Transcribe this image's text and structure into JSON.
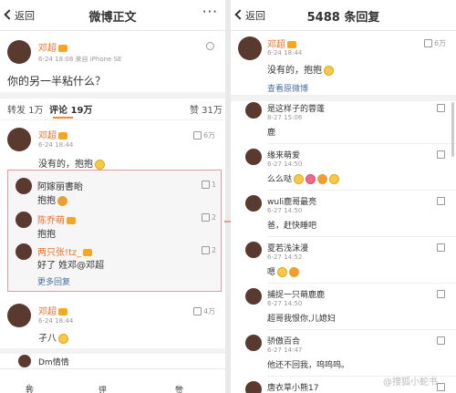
{
  "left": {
    "back_label": "返回",
    "title": "微博正文",
    "more": "···",
    "post": {
      "author": "邓超",
      "meta": "6-24 18:08  来自 iPhone SE",
      "text": "你的另一半粘什么？"
    },
    "tabs": {
      "repost": "转发 1万",
      "comment": "评论 19万",
      "like": "赞 31万"
    },
    "comment1": {
      "author": "邓超",
      "meta": "6-24 18:44",
      "likes": "6万",
      "text": "没有的，抱抱",
      "replies": [
        {
          "author": "阿嫁丽書眙",
          "text": "抱抱",
          "likes": "1"
        },
        {
          "author": "陈乔萌",
          "text": "抱抱",
          "likes": "2"
        },
        {
          "author": "两只张!tz_",
          "text": "好了  姓邓@邓超",
          "likes": "2"
        }
      ],
      "more_replies": "更多回复"
    },
    "comment2": {
      "author": "邓超",
      "meta": "6-24 18:44",
      "likes": "4万",
      "text": "孑八"
    },
    "comment3": {
      "author": "Dm情情"
    },
    "bottom": {
      "repost": "转发",
      "comment": "评论",
      "like": "赞"
    }
  },
  "right": {
    "back_label": "返回",
    "title": "5488 条回复",
    "post": {
      "author": "邓超",
      "meta": "6-24 18:44",
      "likes": "6万",
      "text": "没有的，抱抱",
      "link": "查看原微博"
    },
    "replies": [
      {
        "author": "是这样子的蓉蓬",
        "time": "8-27 15:06",
        "text": "鹿",
        "likes": ""
      },
      {
        "author": "缘来萌爱",
        "time": "6-27 14:50",
        "text": "么么哒",
        "likes": ""
      },
      {
        "author": "wuli鹿哥最亮",
        "time": "6-27 14:50",
        "text": "爸，赶快睡吧",
        "likes": ""
      },
      {
        "author": "夏若浅沫漫",
        "time": "6-27 14:52",
        "text": "嗯",
        "likes": ""
      },
      {
        "author": "捕捉一只萌鹿鹿",
        "time": "6-27 14:50",
        "text": "超哥我恨你,儿媳妇",
        "likes": ""
      },
      {
        "author": "骄傲百合",
        "time": "6-27 14:47",
        "text": "他还不回我，呜呜呜。",
        "likes": ""
      },
      {
        "author": "唐衣草小熊17",
        "time": "",
        "text": "",
        "likes": ""
      }
    ],
    "watermark": "@搜狐小蛇书"
  },
  "colors": {
    "accent": "#f08a2c",
    "username": "#e8722a",
    "link": "#4a6d9c",
    "highlight_box": "#e59a9a"
  }
}
